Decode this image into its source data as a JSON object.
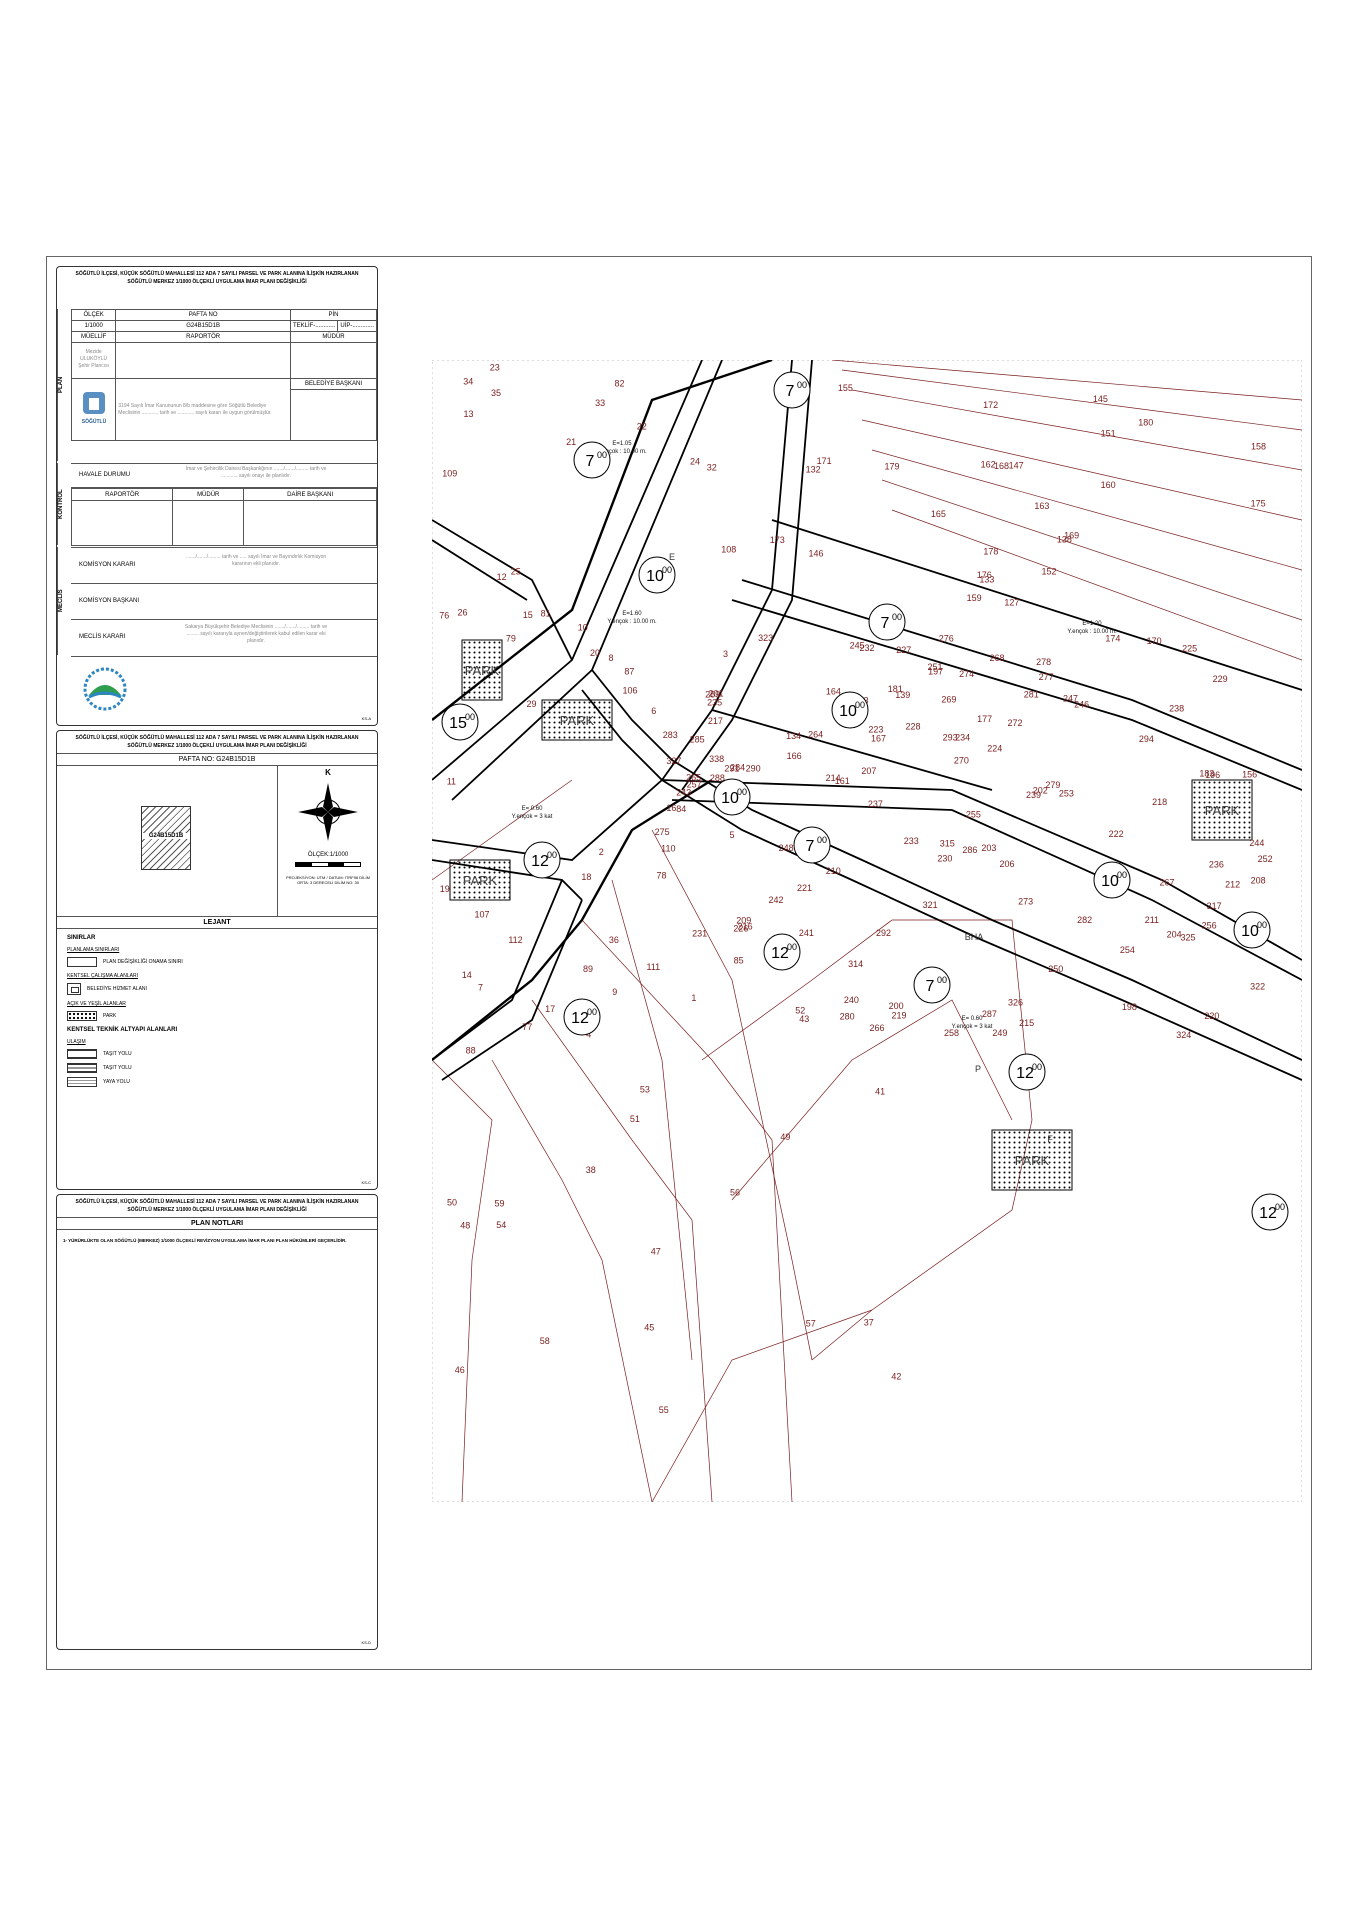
{
  "title_block": {
    "title_line1": "SÖĞÜTLÜ İLÇESİ, KÜÇÜK SÖĞÜTLÜ MAHALLESİ 112  ADA 7 SAYILI PARSEL VE PARK ALANINA İLİŞKİN HAZIRLANAN",
    "title_line2": "SÖĞÜTLÜ MERKEZ 1/1000 ÖLÇEKLİ UYGULAMA İMAR PLANI DEĞİŞİKLİĞİ",
    "h_olcek": "ÖLÇEK",
    "h_pafta": "PAFTA NO",
    "h_pin": "PİN",
    "olcek": "1/1000",
    "pafta": "G24B15D1B",
    "teklif": "TEKLİF-............",
    "uip": "UİP-.............",
    "h_musellif": "MÜELLİF",
    "h_raportor": "RAPORTÖR",
    "h_mudur": "MÜDÜR",
    "musellif_name": "Mezide ULUKÖYLÜ",
    "musellif_role": "Şehir Plancısı",
    "section_plan": "PLAN",
    "belediye_note": "3194 Sayılı İmar Kanununun 8/b maddesine göre Söğütlü Belediye Meclisinin ............ tarih ve ............ sayılı kararı ile uygun görülmüştür.",
    "h_baskan": "BELEDİYE BAŞKANI",
    "logo_text": "SÖĞÜTLÜ",
    "section_kontrol": "KONTROL",
    "havale": "HAVALE DURUMU",
    "havale_note": "İmar ve Şehircilik Dairesi Başkanlığının ......./......./......... tarih ve ............ sayılı onayı ile planlıdır.",
    "k_raportor": "RAPORTÖR",
    "k_mudur": "MÜDÜR",
    "k_daire": "DAİRE BAŞKANI",
    "section_meclis": "MECLİS",
    "komisyon_karari": "KOMİSYON KARARI",
    "komisyon_note": "......./......./......... tarih ve ..... sayılı İmar ve Bayındırlık Komisyon kararının ekli planıdır.",
    "komisyon_baskani": "KOMİSYON BAŞKANI",
    "meclis_karari": "MECLİS KARARI",
    "meclis_note": "Sakarya Büyükşehir Belediye Meclisinin ......./......./......... tarih ve ......... sayılı kararıyla aynen/değiştirilerek kabul edilen karar eki planıdır.",
    "code": "KS-A"
  },
  "legend_block": {
    "title_line1": "SÖĞÜTLÜ İLÇESİ, KÜÇÜK SÖĞÜTLÜ MAHALLESİ 112  ADA 7 SAYILI PARSEL VE PARK ALANINA İLİŞKİN HAZIRLANAN",
    "title_line2": "SÖĞÜTLÜ MERKEZ 1/1000 ÖLÇEKLİ UYGULAMA İMAR PLANI DEĞİŞİKLİĞİ",
    "pafta_label": "PAFTA NO: G24B15D1B",
    "key_sheet": "G24B15D1B",
    "north": "K",
    "scale": "ÖLÇEK:1/1000",
    "projection": "PROJEKSİYON: UTM / DATUM: ITRF96 DİLİM ORTA: 3 DERECELİ DİLİM NO: 30",
    "lejant": "LEJANT",
    "sinirlar": "SINIRLAR",
    "planlama": "PLANLAMA SINIRLARI",
    "plan_degisikligi": "PLAN DEĞİŞİKLİĞİ ONAMA SINIRI",
    "kentsel": "KENTSEL ÇALIŞMA  ALANLARI",
    "belediye_hizmet": "BELEDİYE HİZMET ALANI",
    "acik_yesil": "AÇIK VE YEŞİL  ALANLAR",
    "park": "PARK",
    "teknik": "KENTSEL TEKNİK ALTYAPI ALANLARI",
    "ulasim": "ULAŞIM",
    "tasit1": "TAŞIT YOLU",
    "tasit2": "TAŞIT YOLU",
    "yaya": "YAYA YOLU",
    "code": "KS-C"
  },
  "notes_block": {
    "title_line1": "SÖĞÜTLÜ İLÇESİ, KÜÇÜK SÖĞÜTLÜ MAHALLESİ 112  ADA 7 SAYILI PARSEL VE PARK ALANINA İLİŞKİN HAZIRLANAN",
    "title_line2": "SÖĞÜTLÜ MERKEZ 1/1000 ÖLÇEKLİ UYGULAMA İMAR PLANI DEĞİŞİKLİĞİ",
    "heading": "PLAN NOTLARI",
    "note1": "1- YÜRÜRLÜKTE OLAN SÖĞÜTLÜ (MERKEZ) 1/1000 ÖLÇEKLİ REVİZYON  UYGULAMA İMAR PLANI PLAN HÜKÜMLERİ GEÇERLİDİR.",
    "code": "KS-D"
  },
  "map": {
    "lot_numbers": [
      "127",
      "132",
      "133",
      "134",
      "138",
      "139",
      "145",
      "147",
      "151",
      "152",
      "155",
      "156",
      "146",
      "158",
      "159",
      "160",
      "161",
      "162",
      "163",
      "164",
      "165",
      "166",
      "167",
      "168",
      "169",
      "170",
      "171",
      "172",
      "173",
      "174",
      "175",
      "176",
      "177",
      "178",
      "179",
      "180",
      "181",
      "183",
      "85",
      "84",
      "82",
      "81",
      "79",
      "78",
      "77",
      "76",
      "87",
      "88",
      "89",
      "106",
      "107",
      "108",
      "109",
      "110",
      "111",
      "112",
      "35",
      "34",
      "36",
      "32",
      "33",
      "29",
      "26",
      "25",
      "24",
      "23",
      "22",
      "21",
      "20",
      "19",
      "18",
      "17",
      "16",
      "15",
      "14",
      "13",
      "12",
      "11",
      "10",
      "9",
      "8",
      "7",
      "6",
      "5",
      "4",
      "3",
      "2",
      "1",
      "249",
      "250",
      "251",
      "252",
      "253",
      "254",
      "255",
      "256",
      "257",
      "258",
      "247",
      "246",
      "248",
      "245",
      "244",
      "243",
      "242",
      "241",
      "240",
      "239",
      "238",
      "237",
      "236",
      "235",
      "234",
      "233",
      "232",
      "231",
      "230",
      "229",
      "228",
      "227",
      "226",
      "225",
      "224",
      "223",
      "222",
      "221",
      "220",
      "219",
      "218",
      "217",
      "216",
      "215",
      "214",
      "213",
      "212",
      "211",
      "210",
      "209",
      "208",
      "207",
      "206",
      "205",
      "204",
      "203",
      "202",
      "201",
      "200",
      "198",
      "199",
      "197",
      "196",
      "264",
      "265",
      "266",
      "267",
      "268",
      "269",
      "270",
      "271",
      "272",
      "273",
      "274",
      "275",
      "276",
      "277",
      "338",
      "321",
      "322",
      "323",
      "324",
      "325",
      "326",
      "327",
      "278",
      "279",
      "280",
      "281",
      "282",
      "283",
      "284",
      "285",
      "286",
      "287",
      "288",
      "289",
      "290",
      "291",
      "313",
      "314",
      "315",
      "317",
      "292",
      "293",
      "294",
      "56",
      "55",
      "54",
      "53",
      "57",
      "58",
      "59",
      "52",
      "51",
      "50",
      "49",
      "48",
      "47",
      "46",
      "45",
      "43",
      "42",
      "41",
      "38",
      "37"
    ],
    "zones": [
      {
        "label": "E=1.05",
        "sub": "Y.ençok : 10.00 m."
      },
      {
        "label": "E=1.20",
        "sub": "Y.ençok : 10.00 m."
      },
      {
        "label": "E= 0.60",
        "sub": "Y.ençok = 3 kat"
      },
      {
        "label": "E= 0.60",
        "sub": "Y.ençok = 3 kat"
      },
      {
        "label": "E=1.60",
        "sub": "Y.ençok : 10.00 m."
      }
    ],
    "parks": [
      "PARK",
      "PARK",
      "PARK",
      "PARK",
      "PARK"
    ],
    "widths": [
      {
        "n": "15",
        "s": "00"
      },
      {
        "n": "12",
        "s": "00"
      },
      {
        "n": "12",
        "s": "00"
      },
      {
        "n": "12",
        "s": "00"
      },
      {
        "n": "12",
        "s": "00"
      },
      {
        "n": "12",
        "s": "00"
      },
      {
        "n": "10",
        "s": "00"
      },
      {
        "n": "10",
        "s": "00"
      },
      {
        "n": "10",
        "s": "00"
      },
      {
        "n": "10",
        "s": "00"
      },
      {
        "n": "10",
        "s": "00"
      },
      {
        "n": "7",
        "s": "00"
      },
      {
        "n": "7",
        "s": "00"
      },
      {
        "n": "7",
        "s": "00"
      },
      {
        "n": "7",
        "s": "00"
      },
      {
        "n": "7",
        "s": "00"
      }
    ],
    "misc": [
      "P",
      "F",
      "E",
      "BHA"
    ]
  }
}
